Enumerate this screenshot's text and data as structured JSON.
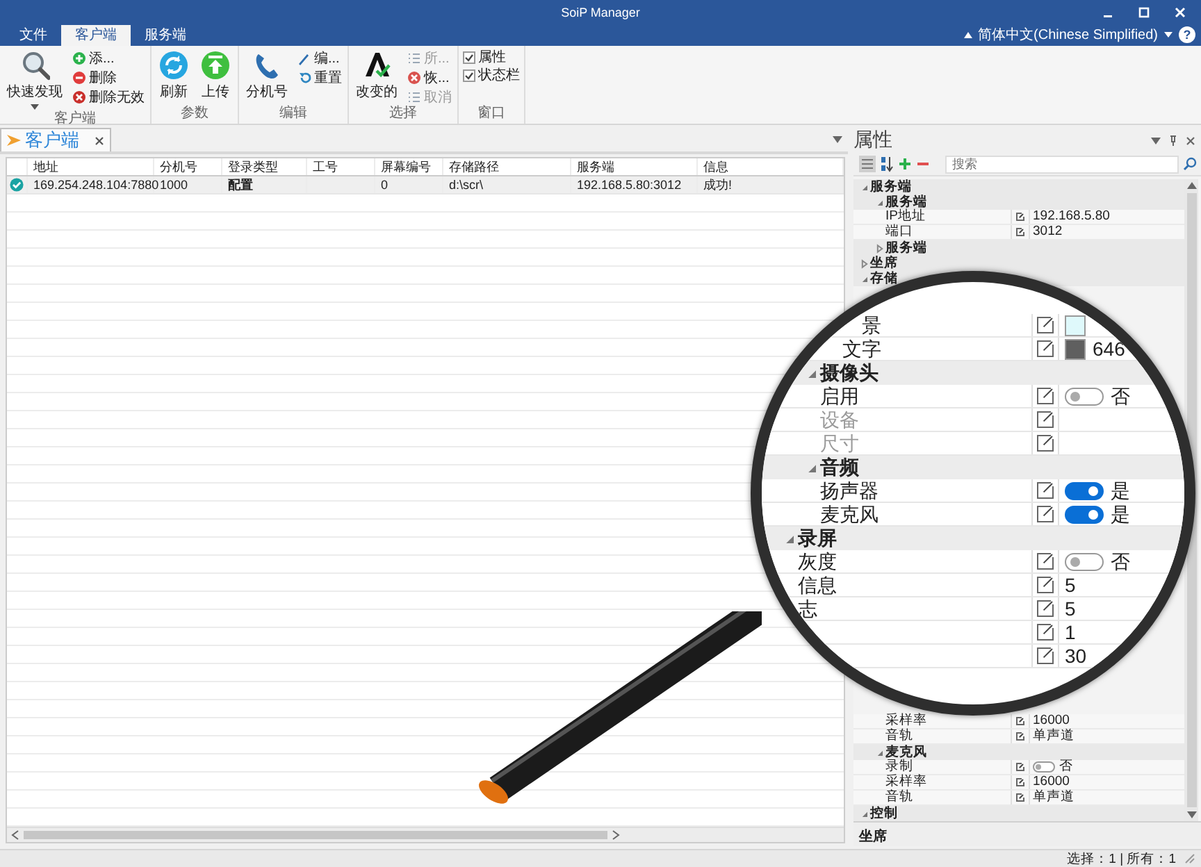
{
  "window": {
    "title": "SoiP Manager",
    "language": "简体中文(Chinese Simplified)",
    "help": "?"
  },
  "ribbon_tabs": [
    {
      "label": "文件",
      "selected": false
    },
    {
      "label": "客户端",
      "selected": true
    },
    {
      "label": "服务端",
      "selected": false
    }
  ],
  "ribbon_groups": [
    {
      "title": "客户端",
      "items": [
        {
          "kind": "large",
          "label": "快速发现",
          "disabled": false
        },
        {
          "kind": "small",
          "label": "添...",
          "disabled": false
        },
        {
          "kind": "small",
          "label": "删除",
          "disabled": false
        },
        {
          "kind": "small",
          "label": "删除无效",
          "disabled": false
        }
      ]
    },
    {
      "title": "参数",
      "items": [
        {
          "kind": "large",
          "label": "刷新",
          "disabled": false
        },
        {
          "kind": "large",
          "label": "上传",
          "disabled": false
        }
      ]
    },
    {
      "title": "编辑",
      "items": [
        {
          "kind": "large",
          "label": "分机号",
          "disabled": false
        },
        {
          "kind": "small",
          "label": "编...",
          "disabled": false
        },
        {
          "kind": "small",
          "label": "重置",
          "disabled": false
        }
      ]
    },
    {
      "title": "选择",
      "items": [
        {
          "kind": "large",
          "label": "改变的",
          "disabled": false
        },
        {
          "kind": "small",
          "label": "所...",
          "disabled": true
        },
        {
          "kind": "small",
          "label": "恢...",
          "disabled": false
        },
        {
          "kind": "small",
          "label": "取消",
          "disabled": true
        }
      ]
    },
    {
      "title": "窗口",
      "items": [
        {
          "kind": "check",
          "label": "属性",
          "checked": true
        },
        {
          "kind": "check",
          "label": "状态栏",
          "checked": true
        }
      ]
    }
  ],
  "document_tabs": [
    {
      "label": "客户端",
      "selected": true
    }
  ],
  "table": {
    "columns": [
      "地址",
      "分机号",
      "登录类型",
      "工号",
      "屏幕编号",
      "存储路径",
      "服务端",
      "信息"
    ],
    "rows": [
      {
        "online": true,
        "cells": [
          "169.254.248.104:7880",
          "1000",
          "配置",
          null,
          "0",
          "d:\\scr\\",
          "192.168.5.80:3012",
          "成功!"
        ]
      }
    ]
  },
  "properties": {
    "title": "属性",
    "search_placeholder": "搜索",
    "upper": [
      {
        "kind": "group",
        "label": "服务端",
        "expanded": true,
        "children": [
          {
            "kind": "group",
            "label": "服务端",
            "expanded": true,
            "children": [
              {
                "kind": "text",
                "label": "IP地址",
                "value": "192.168.5.80"
              },
              {
                "kind": "text",
                "label": "端口",
                "value": "3012"
              }
            ]
          },
          {
            "kind": "group",
            "label": "服务端",
            "expanded": false
          }
        ]
      },
      {
        "kind": "group",
        "label": "坐席",
        "expanded": false
      },
      {
        "kind": "group",
        "label": "存储",
        "expanded": true
      }
    ],
    "lower": [
      {
        "kind": "group",
        "children": [
          {
            "kind": "group",
            "children": [
              {
                "kind": "text",
                "label": "采样率",
                "value": "16000"
              },
              {
                "kind": "text",
                "label": "音轨",
                "value": "单声道"
              }
            ]
          },
          {
            "kind": "group",
            "label": "麦克风",
            "expanded": true,
            "children": [
              {
                "kind": "toggle",
                "label": "录制",
                "on": false,
                "value": "否"
              },
              {
                "kind": "text",
                "label": "采样率",
                "value": "16000"
              },
              {
                "kind": "text",
                "label": "音轨",
                "value": "单声道"
              }
            ]
          }
        ]
      },
      {
        "kind": "group",
        "label": "控制",
        "expanded": true
      }
    ],
    "description": "坐席"
  },
  "magnifier": {
    "rows": [
      {
        "kind": "group",
        "children": [
          {
            "kind": "group",
            "children": [
              {
                "kind": "group",
                "children": [
                  {
                    "kind": "color",
                    "label": "景",
                    "color": "#dff9fb"
                  },
                  {
                    "kind": "color",
                    "label": "文字",
                    "color": "#5f5f5f",
                    "value": "646"
                  }
                ]
              }
            ]
          },
          {
            "kind": "group",
            "label": "摄像头",
            "expanded": true,
            "children": [
              {
                "kind": "toggle",
                "label": "启用",
                "on": false,
                "value": "否",
                "disabled": false
              },
              {
                "kind": "text",
                "label": "设备",
                "disabled": true
              },
              {
                "kind": "text",
                "label": "尺寸",
                "disabled": true
              }
            ]
          },
          {
            "kind": "group",
            "label": "音频",
            "expanded": true,
            "children": [
              {
                "kind": "toggle",
                "label": "扬声器",
                "on": true,
                "value": "是"
              },
              {
                "kind": "toggle",
                "label": "麦克风",
                "on": true,
                "value": "是"
              }
            ]
          }
        ]
      },
      {
        "kind": "group",
        "label": "录屏",
        "expanded": true,
        "children": [
          {
            "kind": "toggle",
            "label": "灰度",
            "on": false,
            "value": "否"
          },
          {
            "kind": "text",
            "label": "信息",
            "value": "5"
          },
          {
            "kind": "text",
            "label": "志",
            "value": "5"
          },
          {
            "kind": "text",
            "value": "1"
          },
          {
            "kind": "text",
            "value": "30"
          }
        ]
      }
    ]
  },
  "status_bar": {
    "text": "选择：1 | 所有：1"
  }
}
